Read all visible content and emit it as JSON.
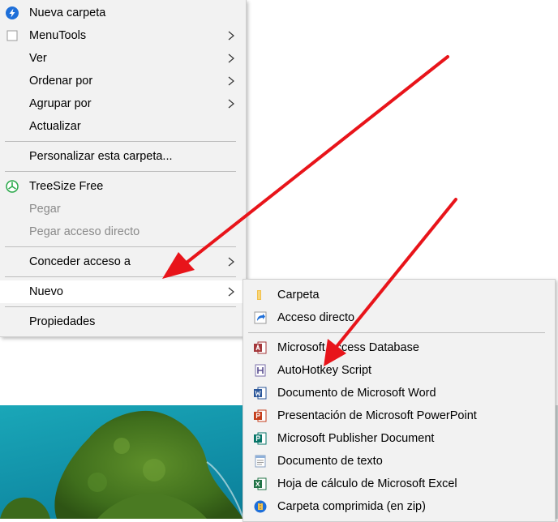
{
  "main_menu": {
    "new_folder": "Nueva carpeta",
    "menutools": "MenuTools",
    "view": "Ver",
    "sort_by": "Ordenar por",
    "group_by": "Agrupar por",
    "refresh": "Actualizar",
    "customize_folder": "Personalizar esta carpeta...",
    "treesize": "TreeSize Free",
    "paste": "Pegar",
    "paste_shortcut": "Pegar acceso directo",
    "give_access": "Conceder acceso a",
    "new": "Nuevo",
    "properties": "Propiedades"
  },
  "sub_menu": {
    "folder": "Carpeta",
    "shortcut": "Acceso directo",
    "access_db": "Microsoft Access Database",
    "autohotkey": "AutoHotkey Script",
    "word_doc": "Documento de Microsoft Word",
    "powerpoint": "Presentación de Microsoft PowerPoint",
    "publisher": "Microsoft Publisher Document",
    "text_doc": "Documento de texto",
    "excel": "Hoja de cálculo de Microsoft Excel",
    "zip_folder": "Carpeta comprimida (en zip)"
  },
  "icons": {
    "new_folder": "lightning-bolt-icon",
    "menutools": "square-icon",
    "treesize": "treesize-icon",
    "chevron": "chevron-right-icon",
    "folder": "folder-icon",
    "shortcut": "shortcut-arrow-icon",
    "access_db": "access-icon",
    "autohotkey": "autohotkey-icon",
    "word_doc": "word-icon",
    "powerpoint": "powerpoint-icon",
    "publisher": "publisher-icon",
    "text_doc": "text-document-icon",
    "excel": "excel-icon",
    "zip_folder": "zip-folder-icon"
  },
  "colors": {
    "menu_bg": "#f2f2f2",
    "highlight": "#ffffff",
    "disabled_text": "#8a8a8a",
    "annotation_arrow": "#e8141a"
  }
}
